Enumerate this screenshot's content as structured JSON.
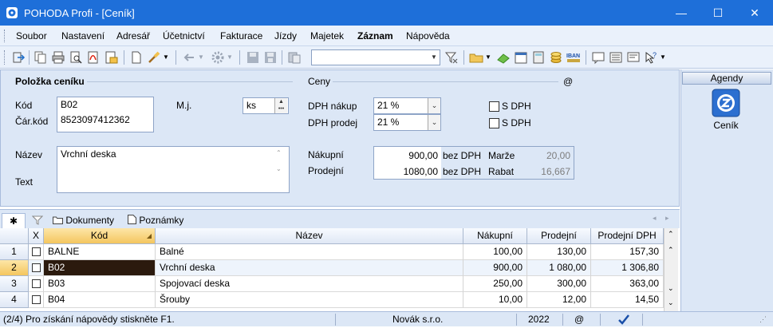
{
  "window": {
    "title": "POHODA Profi - [Ceník]",
    "minimize": "—",
    "maximize": "☐",
    "close": "✕"
  },
  "menu": [
    "Soubor",
    "Nastavení",
    "Adresář",
    "Účetnictví",
    "Fakturace",
    "Jízdy",
    "Majetek",
    "Záznam",
    "Nápověda"
  ],
  "toolbar": {
    "search_value": ""
  },
  "form": {
    "item_section": "Položka ceníku",
    "kod_label": "Kód",
    "kod_value": "B02",
    "carkod_label": "Čár.kód",
    "carkod_value": "8523097412362",
    "mj_label": "M.j.",
    "mj_value": "ks",
    "nazev_label": "Název",
    "nazev_value": "Vrchní deska",
    "text_label": "Text",
    "text_value": "",
    "prices_section": "Ceny",
    "at_sign": "@",
    "dph_nakup_label": "DPH nákup",
    "dph_nakup_value": "21 %",
    "dph_prodej_label": "DPH prodej",
    "dph_prodej_value": "21 %",
    "s_dph_1": "S DPH",
    "s_dph_2": "S DPH",
    "nakupni_label": "Nákupní",
    "nakupni_value": "900,00",
    "nakupni_unit": "bez DPH",
    "prodejni_label": "Prodejní",
    "prodejni_value": "1080,00",
    "prodejni_unit": "bez DPH",
    "marze_label": "Marže",
    "marze_value": "20,00",
    "rabat_label": "Rabat",
    "rabat_value": "16,667"
  },
  "agenda": {
    "header": "Agendy",
    "item": "Ceník"
  },
  "tabs": {
    "star": "✱",
    "documents": "Dokumenty",
    "notes": "Poznámky"
  },
  "grid": {
    "headers": {
      "x": "X",
      "kod": "Kód",
      "nazev": "Název",
      "nakupni": "Nákupní",
      "prodejni": "Prodejní",
      "prodejni_dph": "Prodejní DPH"
    },
    "rows": [
      {
        "num": "1",
        "kod": "BALNE",
        "nazev": "Balné",
        "nakupni": "100,00",
        "prodejni": "130,00",
        "prodejni_dph": "157,30"
      },
      {
        "num": "2",
        "kod": "B02",
        "nazev": "Vrchní deska",
        "nakupni": "900,00",
        "prodejni": "1 080,00",
        "prodejni_dph": "1 306,80"
      },
      {
        "num": "3",
        "kod": "B03",
        "nazev": "Spojovací deska",
        "nakupni": "250,00",
        "prodejni": "300,00",
        "prodejni_dph": "363,00"
      },
      {
        "num": "4",
        "kod": "B04",
        "nazev": "Šrouby",
        "nakupni": "10,00",
        "prodejni": "12,00",
        "prodejni_dph": "14,50"
      }
    ]
  },
  "status": {
    "help": "(2/4) Pro získání nápovědy stiskněte F1.",
    "company": "Novák s.r.o.",
    "year": "2022",
    "at": "@"
  },
  "colors": {
    "titlebar": "#1e6fd9",
    "selected_row": "#eef4fc",
    "active_cell": "#2b1a0e",
    "sort_header": "#f7c96a"
  }
}
